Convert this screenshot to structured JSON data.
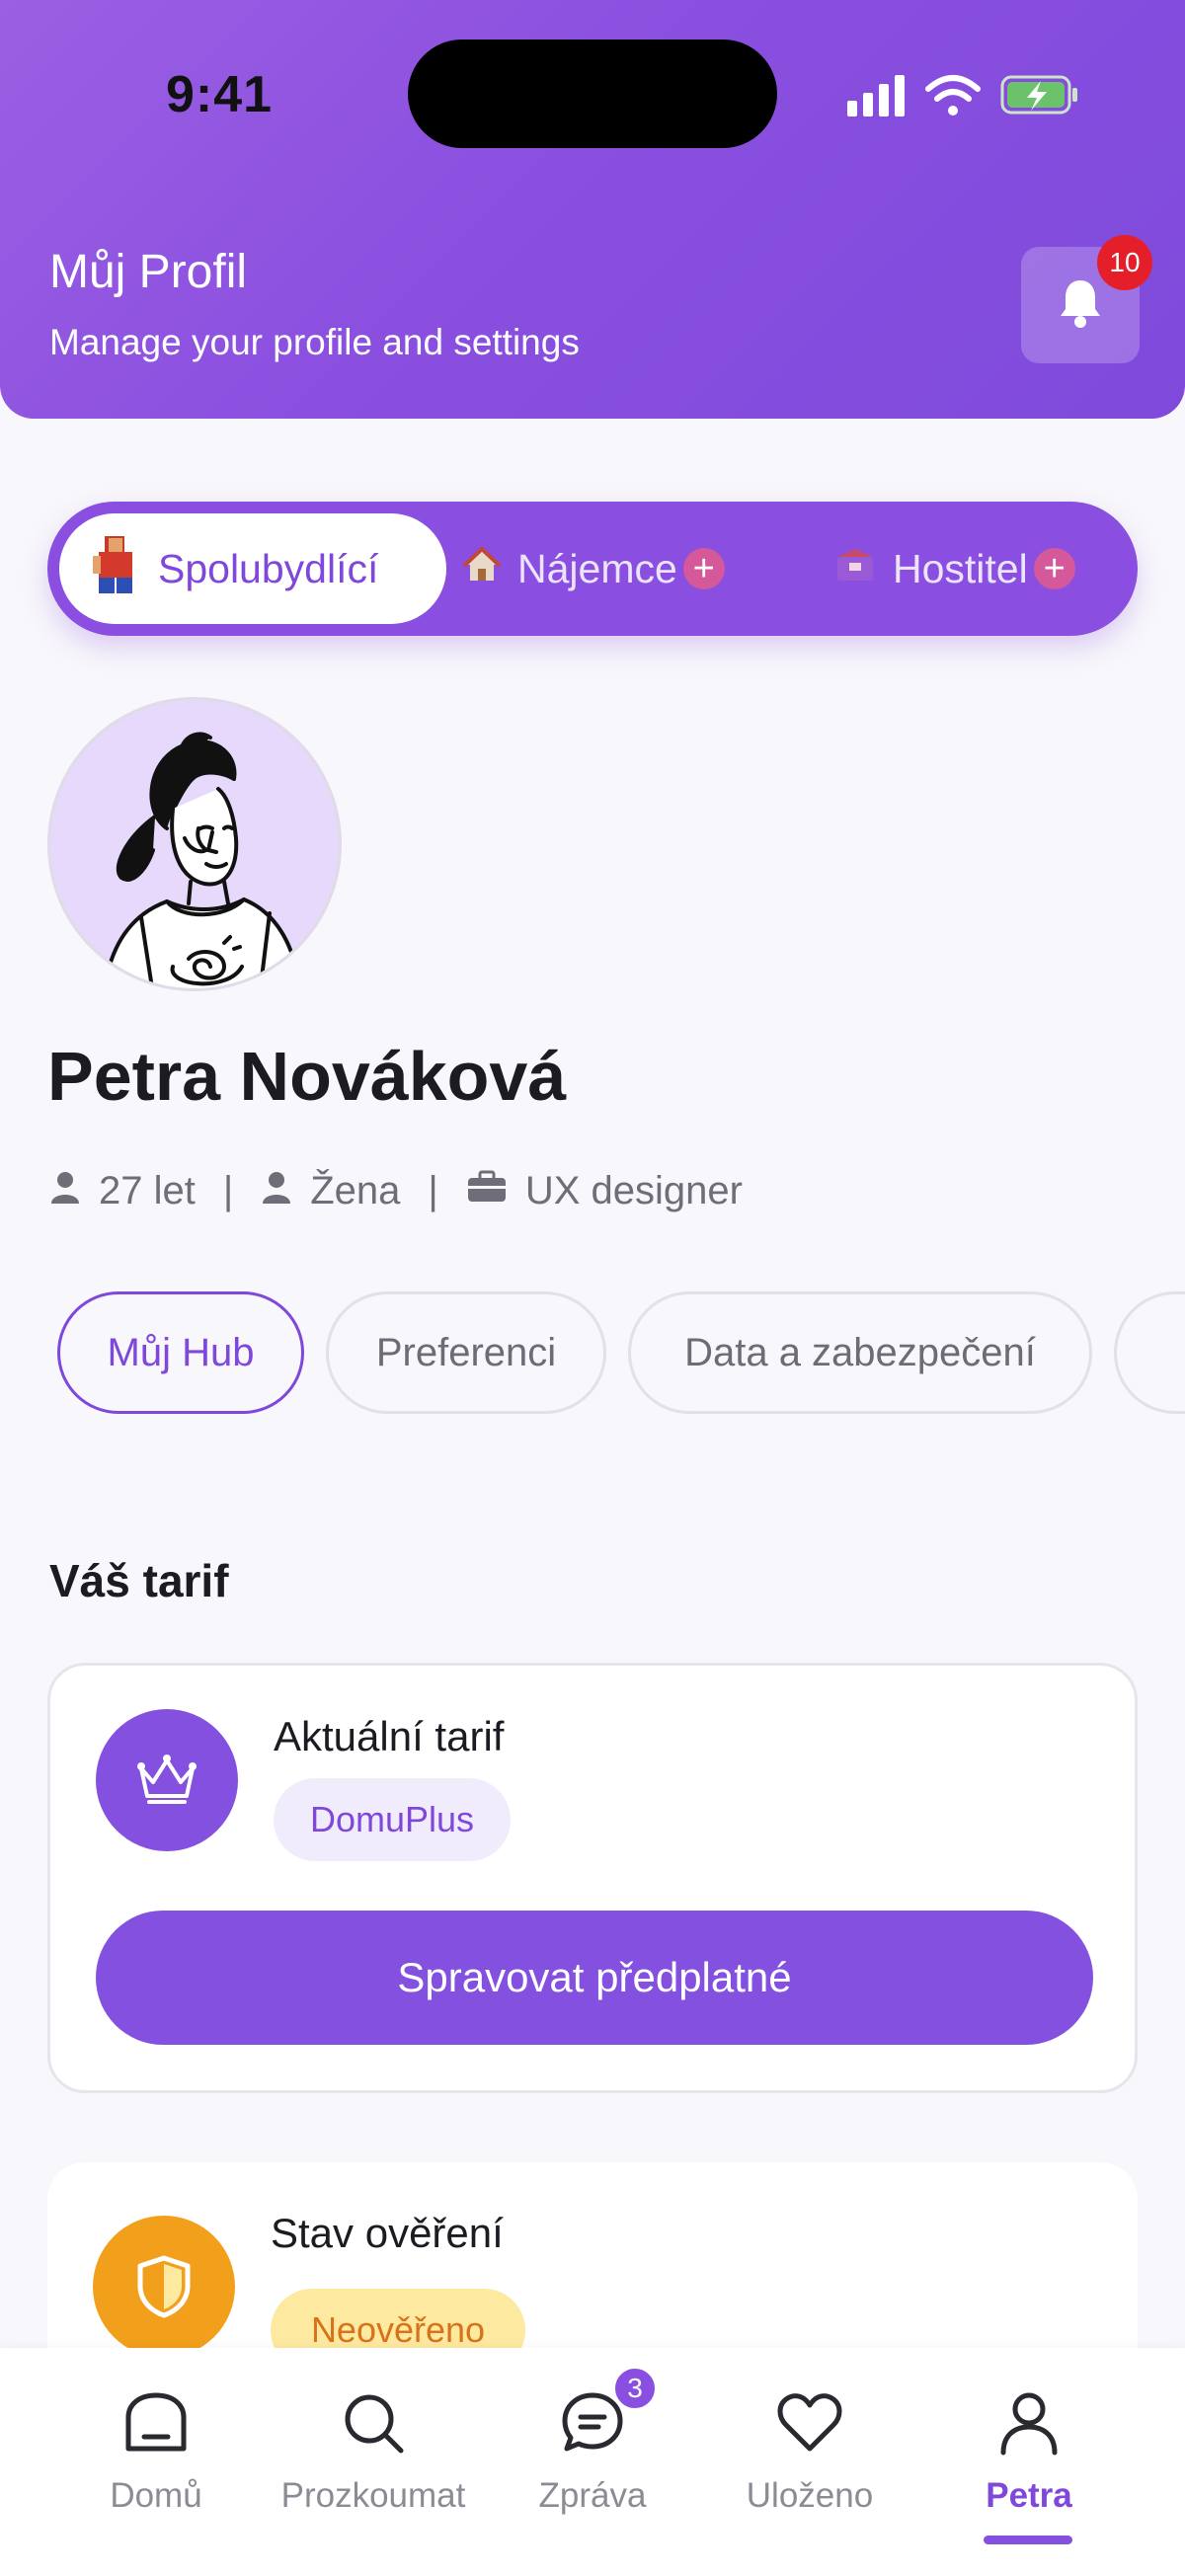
{
  "status_bar": {
    "time": "9:41"
  },
  "header": {
    "title": "Můj Profil",
    "subtitle": "Manage your profile and settings",
    "notifications_count": "10"
  },
  "roles": [
    {
      "label": "Spolubydlící",
      "icon": "roommate-figure-icon",
      "active": true
    },
    {
      "label": "Nájemce",
      "icon": "house-icon",
      "active": false
    },
    {
      "label": "Hostitel",
      "icon": "host-box-icon",
      "active": false
    }
  ],
  "profile": {
    "name": "Petra Nováková",
    "age": "27 let",
    "gender": "Žena",
    "occupation": "UX designer",
    "separator": "|"
  },
  "chips": [
    {
      "label": "Můj Hub",
      "active": true
    },
    {
      "label": "Preferenci",
      "active": false
    },
    {
      "label": "Data a zabezpečení",
      "active": false
    }
  ],
  "plan_section": {
    "title": "Váš tarif",
    "current_label": "Aktuální tarif",
    "plan_name": "DomuPlus",
    "manage_button": "Spravovat předplatné"
  },
  "verification": {
    "title": "Stav ověření",
    "status": "Neověřeno"
  },
  "bottom_nav": [
    {
      "label": "Domů",
      "icon": "home-icon",
      "active": false
    },
    {
      "label": "Prozkoumat",
      "icon": "search-icon",
      "active": false
    },
    {
      "label": "Zpráva",
      "icon": "message-icon",
      "active": false,
      "badge": "3"
    },
    {
      "label": "Uloženo",
      "icon": "heart-icon",
      "active": false
    },
    {
      "label": "Petra",
      "icon": "user-icon",
      "active": true
    }
  ],
  "colors": {
    "primary": "#8450df",
    "header_gradient_start": "#9b5fe3",
    "badge_red": "#e41f2a",
    "warning_orange": "#f2a01c",
    "warning_pill_bg": "#fde9a0",
    "warning_pill_text": "#d8731a"
  }
}
